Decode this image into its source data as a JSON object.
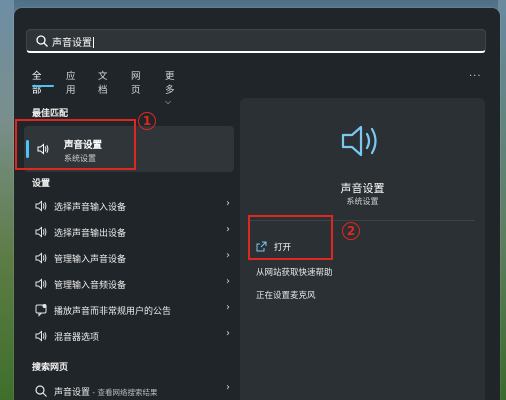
{
  "search": {
    "query": "声音设置"
  },
  "tabs": [
    {
      "label": "全部",
      "active": true
    },
    {
      "label": "应用"
    },
    {
      "label": "文档"
    },
    {
      "label": "网页"
    },
    {
      "label": "更多"
    }
  ],
  "more_dots": "···",
  "best_match": {
    "heading": "最佳匹配",
    "title": "声音设置",
    "subtitle": "系统设置"
  },
  "settings": {
    "heading": "设置",
    "items": [
      {
        "label": "选择声音输入设备",
        "icon": "speaker-icon"
      },
      {
        "label": "选择声音输出设备",
        "icon": "speaker-icon"
      },
      {
        "label": "管理输入声音设备",
        "icon": "speaker-icon"
      },
      {
        "label": "管理输入音频设备",
        "icon": "speaker-icon"
      },
      {
        "label": "播放声音而非常规用户的公告",
        "icon": "notification-icon"
      },
      {
        "label": "混音器选项",
        "icon": "speaker-icon"
      }
    ]
  },
  "web_search": {
    "heading": "搜索网页",
    "item_label": "声音设置",
    "item_suffix": " - 查看网络搜索结果"
  },
  "preview": {
    "title": "声音设置",
    "subtitle": "系统设置",
    "actions": [
      {
        "label": "打开"
      },
      {
        "label": "从网站获取快速帮助"
      },
      {
        "label": "正在设置麦克风"
      }
    ]
  },
  "annotations": {
    "badge1": "1",
    "badge2": "2"
  },
  "colors": {
    "accent": "#4fc3f7",
    "annotation": "#e0271f"
  }
}
